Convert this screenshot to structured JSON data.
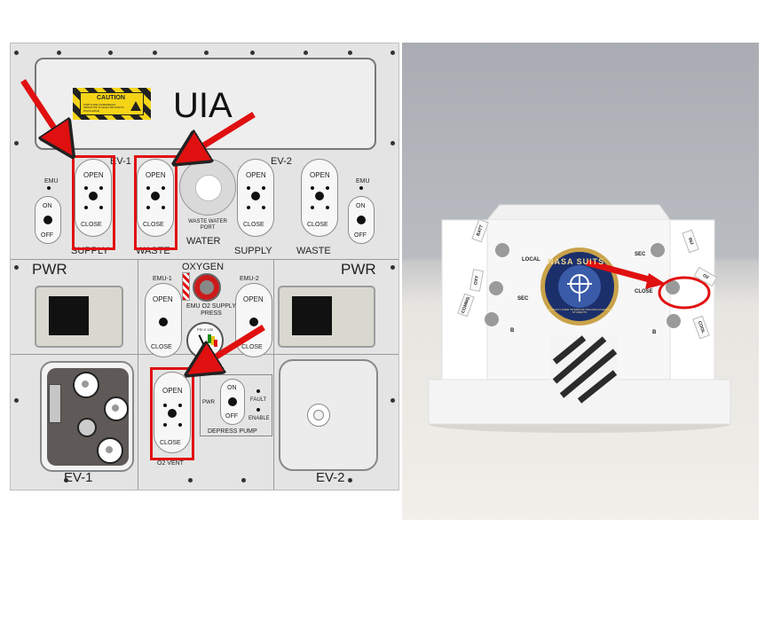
{
  "colors": {
    "highlight_red": "#e01010",
    "caution_yellow": "#f5d417",
    "badge_blue": "#1b2f6b"
  },
  "panel": {
    "title": "UIA",
    "caution": {
      "heading": "CAUTION",
      "note": "PARTS ARE ASSEMBLIES SENSITIVE TO ELECTROSTATIC DISCHARGE"
    },
    "ev1_label": "EV-1",
    "ev2_label": "EV-2",
    "emu_small": "EMU",
    "switch": {
      "open": "OPEN",
      "close": "CLOSE",
      "on": "ON",
      "off": "OFF"
    },
    "sections": {
      "supply": "SUPPLY",
      "waste": "WASTE",
      "water": "WATER",
      "pwr": "PWR",
      "oxygen": "OXYGEN"
    },
    "waste_water_port": "WASTE WATER PORT",
    "emu1": "EMU-1",
    "emu2": "EMU-2",
    "emu_o2_supply_press": "EMU O2 SUPPLY PRESS",
    "gauge_label": "PSI X 100",
    "o2_vent": "O2 VENT",
    "depress_pump": {
      "title": "DEPRESS PUMP",
      "pwr": "PWR",
      "fault": "FAULT",
      "enable": "ENABLE"
    },
    "bottom_ev1": "EV-1",
    "bottom_ev2": "EV-2"
  },
  "photo": {
    "badge_text": "NASA SUITS",
    "badge_subtext": "SPACESUIT USER INTERFACE TECHNOLOGIES FOR STUDENTS",
    "left_labels": {
      "local": "LOCAL",
      "sec": "SEC",
      "b": "B"
    },
    "left_tags": [
      "BATT",
      "OXY",
      "COMMS"
    ],
    "right_labels": {
      "sec": "SEC",
      "close": "CLOSE",
      "b": "B"
    },
    "right_tags": [
      "INJ",
      "O2",
      "COOL"
    ]
  }
}
